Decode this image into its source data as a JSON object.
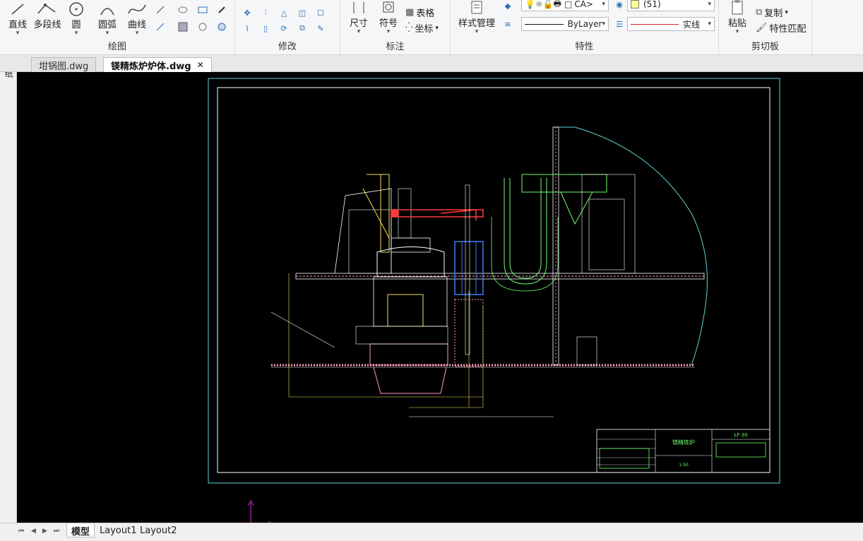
{
  "ribbon": {
    "draw_panel": {
      "title": "绘图",
      "tools": [
        "直线",
        "多段线",
        "圆",
        "圆弧",
        "曲线"
      ]
    },
    "modify_panel": {
      "title": "修改"
    },
    "annotate_panel": {
      "title": "标注",
      "dimension": "尺寸",
      "symbol": "符号",
      "table": "表格",
      "coordinate": "坐标"
    },
    "properties_panel": {
      "title": "特性",
      "style_manager": "样式管理",
      "layer_name": "CA>",
      "color_value": "(51)",
      "linetype": "ByLayer",
      "linestyle": "实线"
    },
    "clipboard_panel": {
      "title": "剪切板",
      "paste": "粘贴",
      "copy": "复制",
      "match_properties": "特性匹配"
    }
  },
  "tabs": [
    {
      "label": "坩锅图.dwg",
      "active": false
    },
    {
      "label": "镁精炼炉炉体.dwg",
      "active": true
    }
  ],
  "left_strip": {
    "label": "图纸"
  },
  "titleblock": {
    "name": "镁精炼炉",
    "code": "LF-30",
    "scale": "1:50"
  },
  "layout_tabs": [
    "模型",
    "Layout1",
    "Layout2"
  ],
  "colors": {
    "canvas_bg": "#000000",
    "frame_cyan": "#5fd3d3",
    "white_line": "#ffffff",
    "yellow": "#f5e35a",
    "red": "#ff3a3a",
    "green": "#6cff6c",
    "blue": "#3a7dff",
    "pink": "#ff9ab8",
    "ucs_magenta": "#d633d6"
  }
}
